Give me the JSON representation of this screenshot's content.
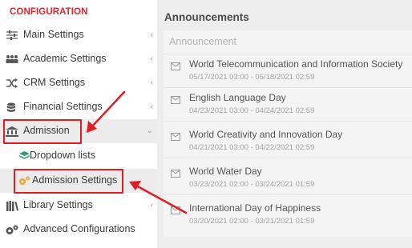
{
  "sidebar": {
    "header": "CONFIGURATION",
    "items": [
      {
        "label": "Main Settings",
        "icon": "sliders-icon"
      },
      {
        "label": "Academic Settings",
        "icon": "users-group-icon"
      },
      {
        "label": "CRM Settings",
        "icon": "shuffle-icon"
      },
      {
        "label": "Financial Settings",
        "icon": "database-coins-icon"
      },
      {
        "label": "Admission",
        "icon": "institution-icon"
      },
      {
        "label": "Dropdown lists",
        "icon": "layers-icon"
      },
      {
        "label": "Admission Settings",
        "icon": "gears-icon"
      },
      {
        "label": "Library Settings",
        "icon": "books-icon"
      },
      {
        "label": "Advanced Configurations",
        "icon": "cogs-icon"
      }
    ]
  },
  "main": {
    "title": "Announcements",
    "table_header": "Announcement",
    "announcements": [
      {
        "title": "World Telecommunication and Information Society",
        "dates": "05/17/2021 03:00 - 05/18/2021 02:59"
      },
      {
        "title": "English Language Day",
        "dates": "04/23/2021 03:00 - 04/24/2021 02:59"
      },
      {
        "title": "World Creativity and Innovation Day",
        "dates": "04/21/2021 03:00 - 04/22/2021 02:59"
      },
      {
        "title": "World Water Day",
        "dates": "03/23/2021 02:00 - 03/24/2021 01:59"
      },
      {
        "title": "International Day of Happiness",
        "dates": "03/20/2021 02:00 - 03/21/2021 01:59"
      }
    ]
  },
  "colors": {
    "header_red": "#d9282f",
    "highlight_border": "#e31b23",
    "arrow": "#e31b23"
  }
}
